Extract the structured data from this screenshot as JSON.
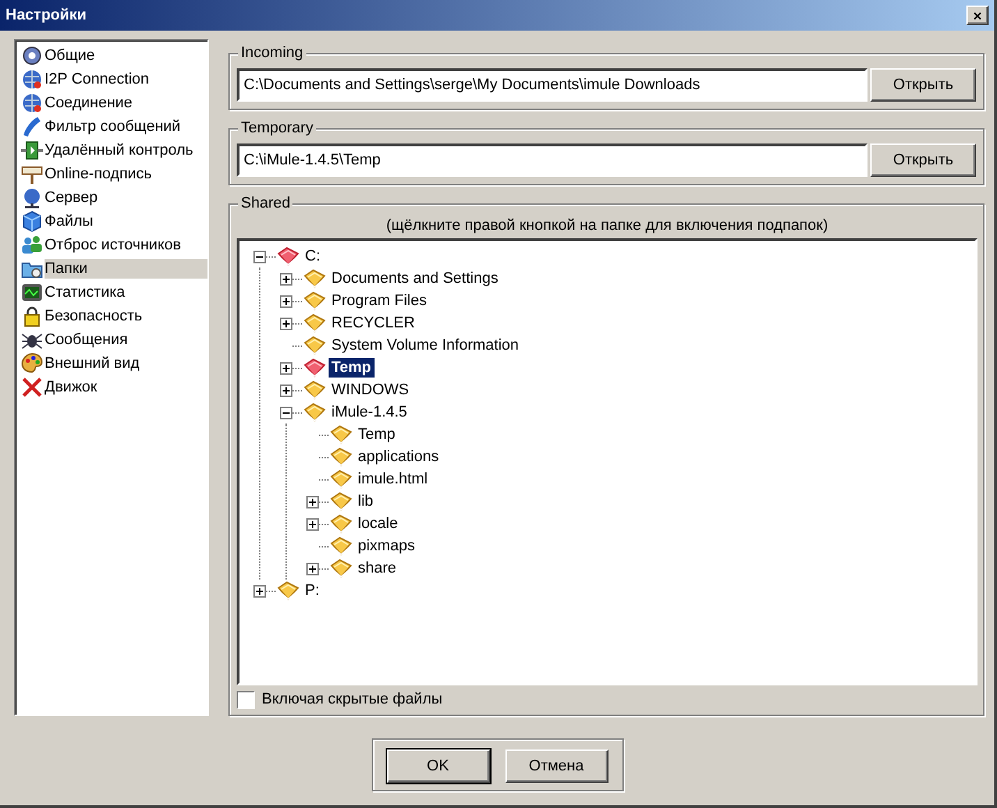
{
  "window": {
    "title": "Настройки"
  },
  "sidebar": {
    "items": [
      {
        "label": "Общие",
        "selected": false
      },
      {
        "label": "I2P Connection",
        "selected": false
      },
      {
        "label": "Соединение",
        "selected": false
      },
      {
        "label": "Фильтр сообщений",
        "selected": false
      },
      {
        "label": "Удалённый контроль",
        "selected": false
      },
      {
        "label": "Online-подпись",
        "selected": false
      },
      {
        "label": "Сервер",
        "selected": false
      },
      {
        "label": "Файлы",
        "selected": false
      },
      {
        "label": "Отброс источников",
        "selected": false
      },
      {
        "label": "Папки",
        "selected": true
      },
      {
        "label": "Статистика",
        "selected": false
      },
      {
        "label": "Безопасность",
        "selected": false
      },
      {
        "label": "Сообщения",
        "selected": false
      },
      {
        "label": "Внешний вид",
        "selected": false
      },
      {
        "label": "Движок",
        "selected": false
      }
    ]
  },
  "incoming": {
    "title": "Incoming",
    "value": "C:\\Documents and Settings\\serge\\My Documents\\imule Downloads",
    "button": "Открыть"
  },
  "temporary": {
    "title": "Temporary",
    "value": "C:\\iMule-1.4.5\\Temp",
    "button": "Открыть"
  },
  "shared": {
    "title": "Shared",
    "hint": "(щёлкните правой кнопкой на папке для включения подпапок)",
    "tree": [
      {
        "label": "C:",
        "shared": true,
        "selected": false,
        "expanded": true,
        "children": [
          {
            "label": "Documents and Settings",
            "shared": false,
            "selected": false,
            "expanded": false
          },
          {
            "label": "Program Files",
            "shared": false,
            "selected": false,
            "expanded": false
          },
          {
            "label": "RECYCLER",
            "shared": false,
            "selected": false,
            "expanded": false
          },
          {
            "label": "System Volume Information",
            "shared": false,
            "selected": false
          },
          {
            "label": "Temp",
            "shared": true,
            "selected": true,
            "expanded": false
          },
          {
            "label": "WINDOWS",
            "shared": false,
            "selected": false,
            "expanded": false
          },
          {
            "label": "iMule-1.4.5",
            "shared": false,
            "selected": false,
            "expanded": true,
            "children": [
              {
                "label": "Temp",
                "shared": false,
                "selected": false
              },
              {
                "label": "applications",
                "shared": false,
                "selected": false
              },
              {
                "label": "imule.html",
                "shared": false,
                "selected": false
              },
              {
                "label": "lib",
                "shared": false,
                "selected": false,
                "expanded": false
              },
              {
                "label": "locale",
                "shared": false,
                "selected": false,
                "expanded": false
              },
              {
                "label": "pixmaps",
                "shared": false,
                "selected": false
              },
              {
                "label": "share",
                "shared": false,
                "selected": false,
                "expanded": false
              }
            ]
          }
        ]
      },
      {
        "label": "P:",
        "shared": false,
        "selected": false,
        "expanded": false
      }
    ],
    "include_hidden": {
      "label": "Включая скрытые файлы",
      "checked": false
    }
  },
  "buttons": [
    {
      "label": "OK",
      "default": true
    },
    {
      "label": "Отмена",
      "default": false
    }
  ]
}
